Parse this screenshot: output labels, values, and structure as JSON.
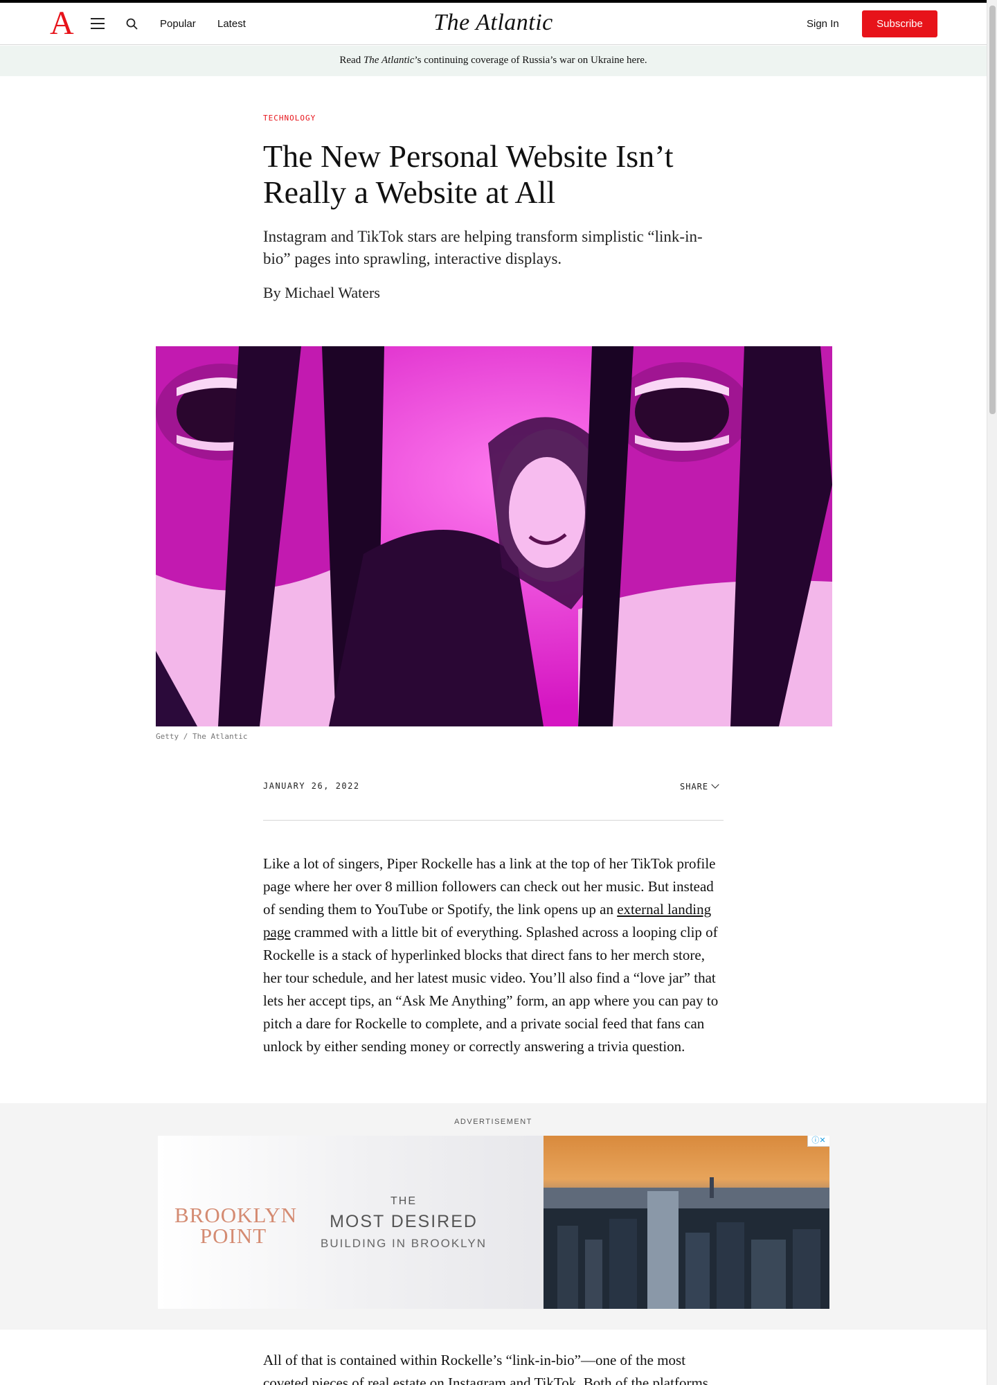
{
  "header": {
    "logo": "A",
    "wordmark": "The Atlantic",
    "nav": [
      "Popular",
      "Latest"
    ],
    "sign_in": "Sign In",
    "subscribe": "Subscribe"
  },
  "banner": {
    "prefix": "Read ",
    "italic": "The Atlantic",
    "suffix": "’s continuing coverage of Russia’s war on Ukraine here."
  },
  "article": {
    "section": "TECHNOLOGY",
    "headline": "The New Personal Website Isn’t Really a Website at All",
    "dek": "Instagram and TikTok stars are helping transform simplistic “link-in-bio” pages into sprawling, interactive displays.",
    "byline_prefix": "By ",
    "author": "Michael Waters",
    "image_credit": "Getty / The Atlantic",
    "date": "JANUARY 26, 2022",
    "share": "SHARE",
    "p1_before_link": "Like a lot of singers, Piper Rockelle has a link at the top of her TikTok profile page where her over 8 million followers can check out her music. But instead of sending them to YouTube or Spotify, the link opens up an ",
    "p1_link": "external landing page",
    "p1_after_link": " crammed with a little bit of everything. Splashed across a looping clip of Rockelle is a stack of hyperlinked blocks that direct fans to her merch store, her tour schedule, and her latest music video. You’ll also find a “love jar” that lets her accept tips, an “Ask Me Anything” form, an app where you can pay to pitch a dare for Rockelle to complete, and a private social feed that fans can unlock by either sending money or correctly answering a trivia question.",
    "p2": "All of that is contained within Rockelle’s “link-in-bio”—one of the most coveted pieces of real estate on Instagram and TikTok. Both of the platforms"
  },
  "ad": {
    "label": "ADVERTISEMENT",
    "brand_line1": "BROOKLYN",
    "brand_line2": "POINT",
    "tag_the": "THE",
    "tag_most": "MOST DESIRED",
    "tag_building": "BUILDING IN BROOKLYN",
    "choices": "ⓘ✕"
  },
  "colors": {
    "brand_red": "#e7131a",
    "banner_bg": "#eef4f1",
    "image_magenta": "#e01ec8"
  },
  "icons": [
    "menu-icon",
    "search-icon",
    "chevron-down-icon",
    "ad-info-icon"
  ]
}
